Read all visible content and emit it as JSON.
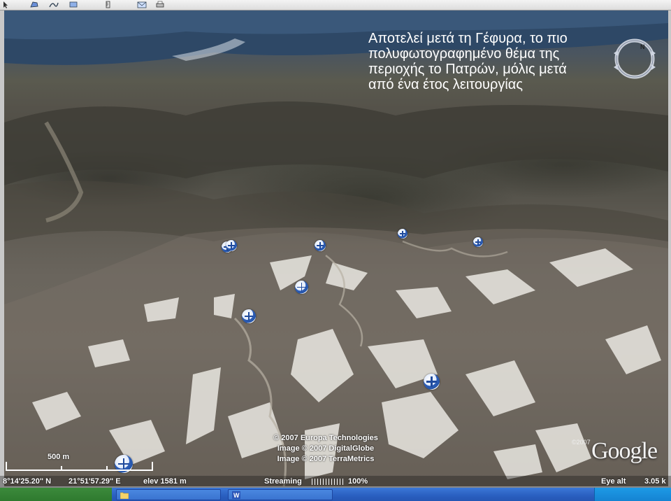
{
  "toolbar": {
    "icons": [
      "cursor-icon",
      "polygon-icon",
      "path-icon",
      "overlay-icon",
      "ruler-icon",
      "email-icon",
      "print-icon"
    ]
  },
  "caption": {
    "lines": [
      "Αποτελεί μετά τη Γέφυρα, το πιο",
      "πολυφωτογραφημένο θέμα της",
      "περιοχής το Πατρών, μόλις μετά",
      "από ένα έτος λειτουργίας"
    ]
  },
  "credits": {
    "line1": "© 2007 Europa Technologies",
    "line2": "Image © 2007 DigitalGlobe",
    "line3": "Image © 2007 TerraMetrics",
    "copyright": "©2007",
    "brand": "Google"
  },
  "scale": {
    "label": "500 m"
  },
  "status": {
    "lat": "8°14'25.20\" N",
    "lon": "21°51'57.29\" E",
    "elev": "elev 1581 m",
    "streaming_label": "Streaming",
    "streaming_percent": "100%",
    "eye_alt_label": "Eye alt",
    "eye_alt_value": "3.05 k"
  },
  "markers": [
    {
      "name": "wind-turbine-1"
    },
    {
      "name": "wind-turbine-2"
    },
    {
      "name": "wind-turbine-3"
    },
    {
      "name": "wind-turbine-4"
    },
    {
      "name": "wind-turbine-5"
    },
    {
      "name": "wind-turbine-6"
    },
    {
      "name": "wind-turbine-7"
    },
    {
      "name": "wind-turbine-8"
    },
    {
      "name": "wind-turbine-9"
    }
  ],
  "colors": {
    "taskbar": "#2a5fc0",
    "start": "#2f7a2f",
    "marker": "#2454a8",
    "caption_text": "#ffffff"
  }
}
